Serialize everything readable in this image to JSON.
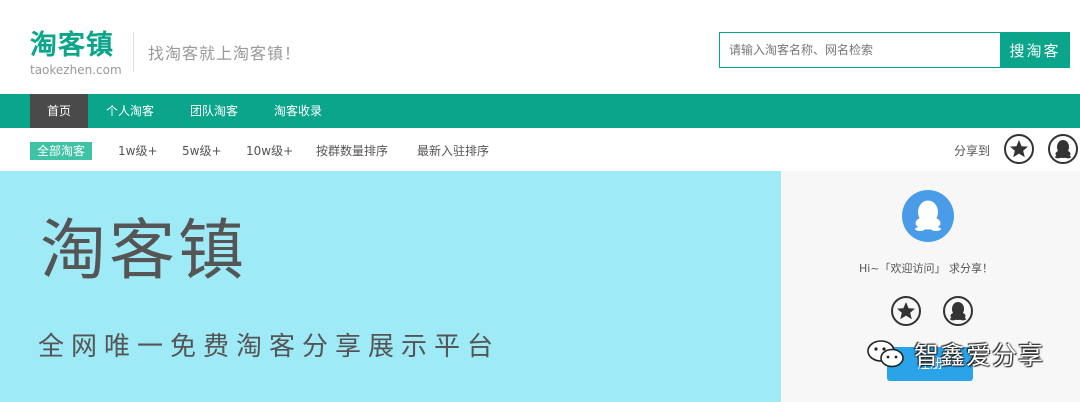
{
  "header": {
    "logo_text": "淘客镇",
    "logo_domain": "taokezhen.com",
    "slogan": "找淘客就上淘客镇！",
    "search_placeholder": "请输入淘客名称、网名检索",
    "search_button": "搜淘客"
  },
  "nav": {
    "items": [
      {
        "label": "首页",
        "active": true
      },
      {
        "label": "个人淘客",
        "active": false
      },
      {
        "label": "团队淘客",
        "active": false
      },
      {
        "label": "淘客收录",
        "active": false
      }
    ]
  },
  "filter": {
    "items": [
      {
        "label": "全部淘客",
        "active": true
      },
      {
        "label": "1w级+",
        "active": false
      },
      {
        "label": "5w级+",
        "active": false
      },
      {
        "label": "10w级+",
        "active": false
      },
      {
        "label": "按群数量排序",
        "active": false
      },
      {
        "label": "最新入驻排序",
        "active": false
      }
    ],
    "share_label": "分享到"
  },
  "banner": {
    "title": "淘客镇",
    "subtitle": "全网唯一免费淘客分享展示平台"
  },
  "panel": {
    "welcome": "Hi~「欢迎访问」 求分享！",
    "login_button": "注册"
  },
  "watermark": {
    "text": "智鑫爱分享"
  },
  "colors": {
    "brand_green": "#0aa58a",
    "filter_active": "#3fc2a6",
    "nav_active": "#4a4a4a",
    "banner_bg": "#9eeaf6",
    "panel_bg": "#f7f7f7",
    "qq_blue": "#4a9be8",
    "login_blue": "#2aa3e8"
  },
  "icons": {
    "share_star": "star-share-icon",
    "share_qq": "qq-share-icon"
  }
}
